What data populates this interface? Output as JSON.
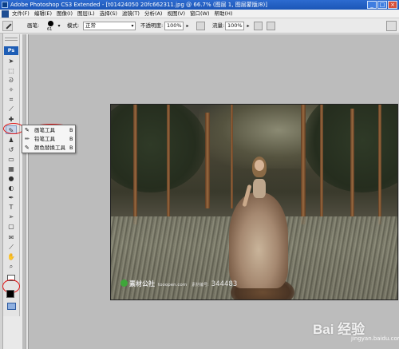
{
  "window": {
    "title": "Adobe Photoshop CS3 Extended - [t01424050 20fc662311.jpg @ 66.7% (图层 1, 图层蒙版/8)]",
    "buttons": [
      "_",
      "□",
      "×"
    ]
  },
  "menubar": {
    "items": [
      "文件(F)",
      "编辑(E)",
      "图像(I)",
      "图层(L)",
      "选择(S)",
      "滤镜(T)",
      "分析(A)",
      "视图(V)",
      "窗口(W)",
      "帮助(H)"
    ]
  },
  "options": {
    "brush_label": "画笔:",
    "brush_size": "61",
    "mode_label": "模式:",
    "mode_value": "正常",
    "opacity_label": "不透明度:",
    "opacity_value": "100%",
    "flow_label": "流量:",
    "flow_value": "100%"
  },
  "toolbox": {
    "badge": "Ps"
  },
  "flyout": {
    "items": [
      {
        "label": "画笔工具",
        "key": "B"
      },
      {
        "label": "铅笔工具",
        "key": "B"
      },
      {
        "label": "颜色替换工具",
        "key": "B"
      }
    ]
  },
  "photo": {
    "watermark_brand": "素材公社",
    "watermark_site": "tooopen.com",
    "watermark_label": "素材编号:",
    "watermark_number": "344483"
  },
  "baidu": {
    "logo": "Bai 经验",
    "url": "jingyan.baidu.com"
  },
  "colors": {
    "foreground": "#000000",
    "background": "#ffffff",
    "annotation": "#e01818"
  }
}
